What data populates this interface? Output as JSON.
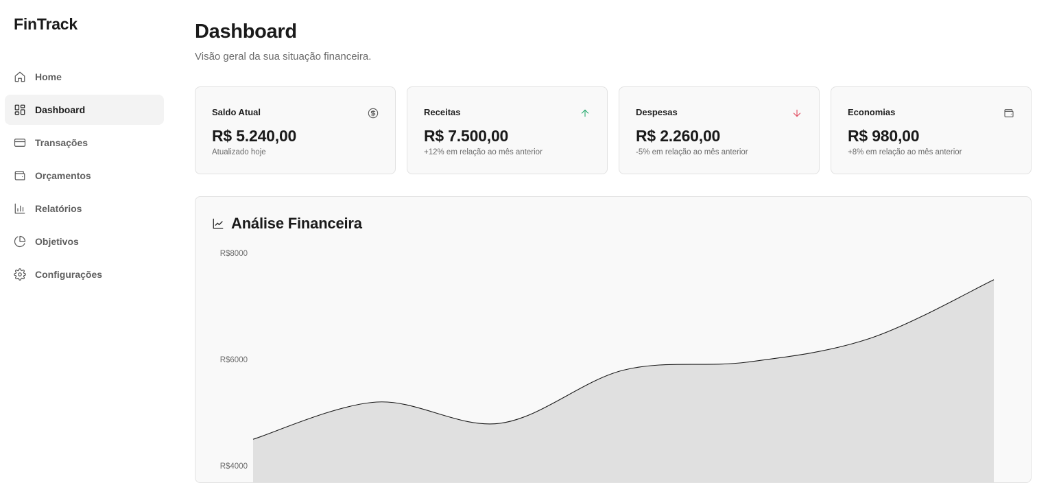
{
  "app": {
    "brand": "FinTrack"
  },
  "sidebar": {
    "items": [
      {
        "label": "Home",
        "icon": "home-icon",
        "active": false
      },
      {
        "label": "Dashboard",
        "icon": "dashboard-grid-icon",
        "active": true
      },
      {
        "label": "Transações",
        "icon": "credit-card-icon",
        "active": false
      },
      {
        "label": "Orçamentos",
        "icon": "wallet-icon",
        "active": false
      },
      {
        "label": "Relatórios",
        "icon": "bar-chart-icon",
        "active": false
      },
      {
        "label": "Objetivos",
        "icon": "pie-chart-icon",
        "active": false
      },
      {
        "label": "Configurações",
        "icon": "gear-icon",
        "active": false
      }
    ]
  },
  "header": {
    "title": "Dashboard",
    "subtitle": "Visão geral da sua situação financeira."
  },
  "cards": [
    {
      "label": "Saldo Atual",
      "value": "R$ 5.240,00",
      "note": "Atualizado hoje",
      "icon": "dollar-circle-icon",
      "icon_color": "#555555"
    },
    {
      "label": "Receitas",
      "value": "R$ 7.500,00",
      "note": "+12% em relação ao mês anterior",
      "icon": "arrow-up-icon",
      "icon_color": "#22a86b"
    },
    {
      "label": "Despesas",
      "value": "R$ 2.260,00",
      "note": "-5% em relação ao mês anterior",
      "icon": "arrow-down-icon",
      "icon_color": "#e0475c"
    },
    {
      "label": "Economias",
      "value": "R$ 980,00",
      "note": "+8% em relação ao mês anterior",
      "icon": "wallet-icon",
      "icon_color": "#555555"
    }
  ],
  "analysis": {
    "title": "Análise Financeira",
    "icon": "line-chart-icon"
  },
  "chart_data": {
    "type": "area",
    "title": "Análise Financeira",
    "xlabel": "",
    "ylabel": "",
    "y_ticks": [
      "R$8000",
      "R$6000",
      "R$4000"
    ],
    "y_tick_values": [
      8000,
      6000,
      4000
    ],
    "ylim": [
      4000,
      8000
    ],
    "x": [
      0,
      1,
      2,
      3,
      4,
      5,
      6
    ],
    "series": [
      {
        "values": [
          4500,
          5200,
          4800,
          5800,
          5950,
          6400,
          7500
        ]
      }
    ],
    "grid": false,
    "fill_color": "#e0e0e0",
    "line_color": "#1a1a1a"
  }
}
